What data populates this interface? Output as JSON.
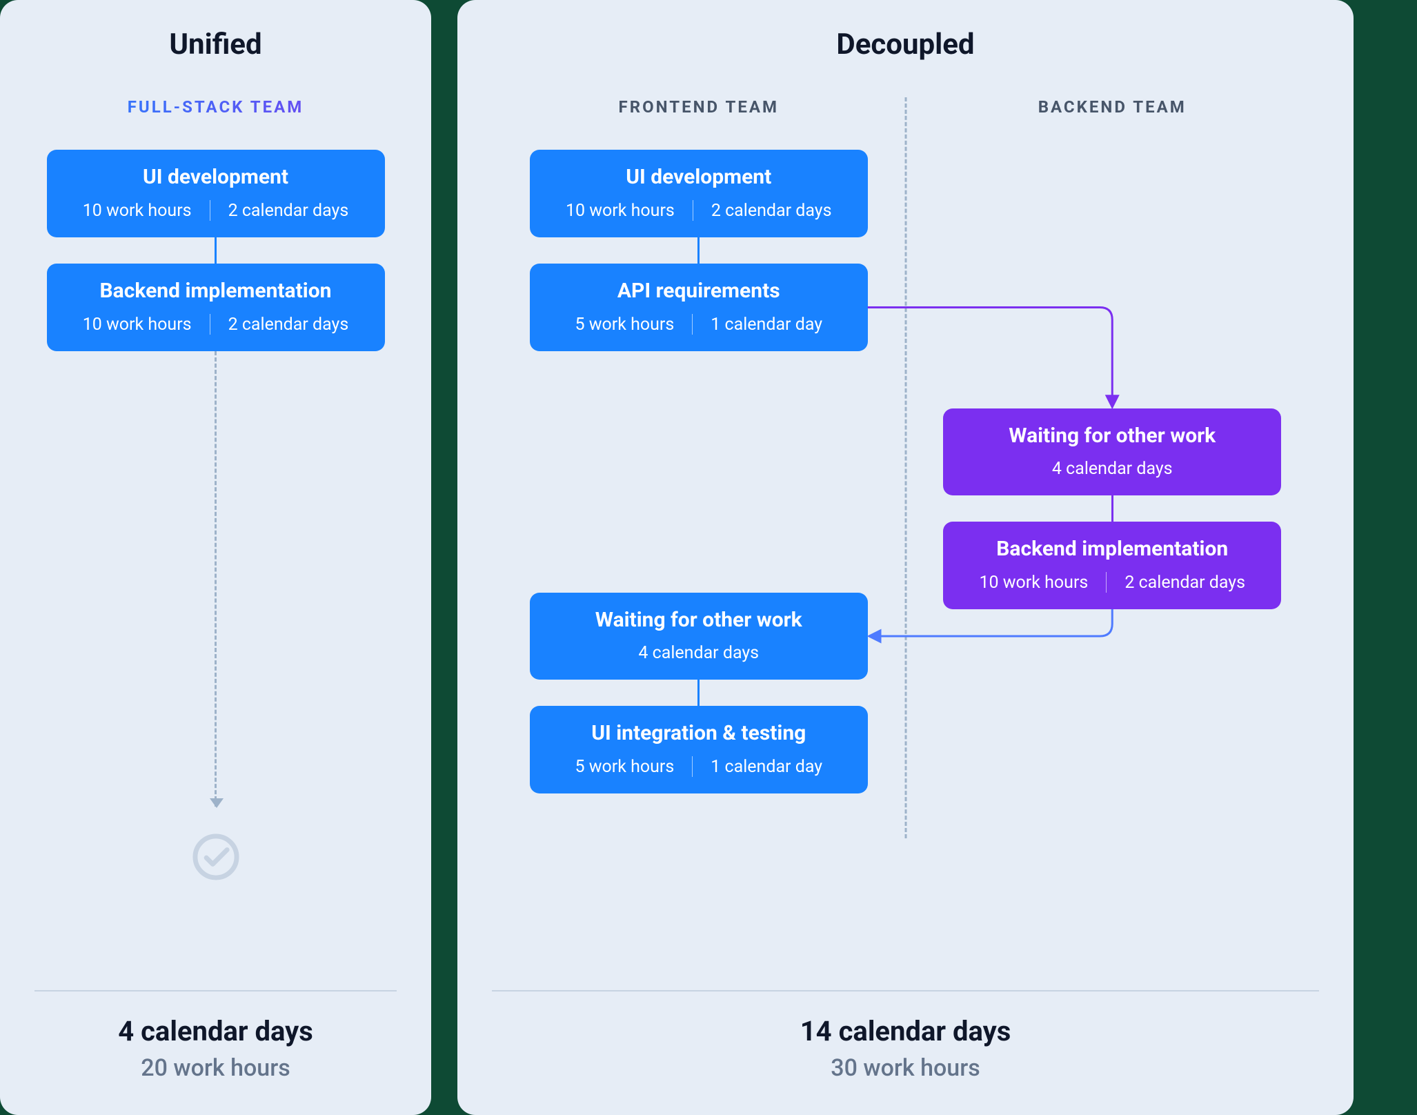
{
  "colors": {
    "blue": "#1982ff",
    "purple": "#7b2ff0",
    "panel_bg": "#e6edf6",
    "text_dark": "#0f172a",
    "text_muted": "#64748b",
    "divider": "#9db2c9"
  },
  "unified": {
    "title": "Unified",
    "team_label": "FULL-STACK TEAM",
    "steps": [
      {
        "title": "UI development",
        "work_hours": "10 work hours",
        "calendar": "2 calendar days",
        "color": "blue"
      },
      {
        "title": "Backend implementation",
        "work_hours": "10 work hours",
        "calendar": "2 calendar days",
        "color": "blue"
      }
    ],
    "totals": {
      "days": "4 calendar days",
      "hours": "20 work hours"
    }
  },
  "decoupled": {
    "title": "Decoupled",
    "frontend_label": "FRONTEND TEAM",
    "backend_label": "BACKEND TEAM",
    "frontend_steps": [
      {
        "title": "UI development",
        "work_hours": "10 work hours",
        "calendar": "2 calendar days",
        "color": "blue"
      },
      {
        "title": "API requirements",
        "work_hours": "5 work hours",
        "calendar": "1 calendar day",
        "color": "blue"
      },
      {
        "title": "Waiting for other work",
        "work_hours": "",
        "calendar": "4 calendar days",
        "color": "blue"
      },
      {
        "title": "UI integration & testing",
        "work_hours": "5 work hours",
        "calendar": "1 calendar day",
        "color": "blue"
      }
    ],
    "backend_steps": [
      {
        "title": "Waiting for other work",
        "work_hours": "",
        "calendar": "4 calendar days",
        "color": "purple"
      },
      {
        "title": "Backend implementation",
        "work_hours": "10 work hours",
        "calendar": "2 calendar days",
        "color": "purple"
      }
    ],
    "totals": {
      "days": "14 calendar days",
      "hours": "30 work hours"
    }
  }
}
